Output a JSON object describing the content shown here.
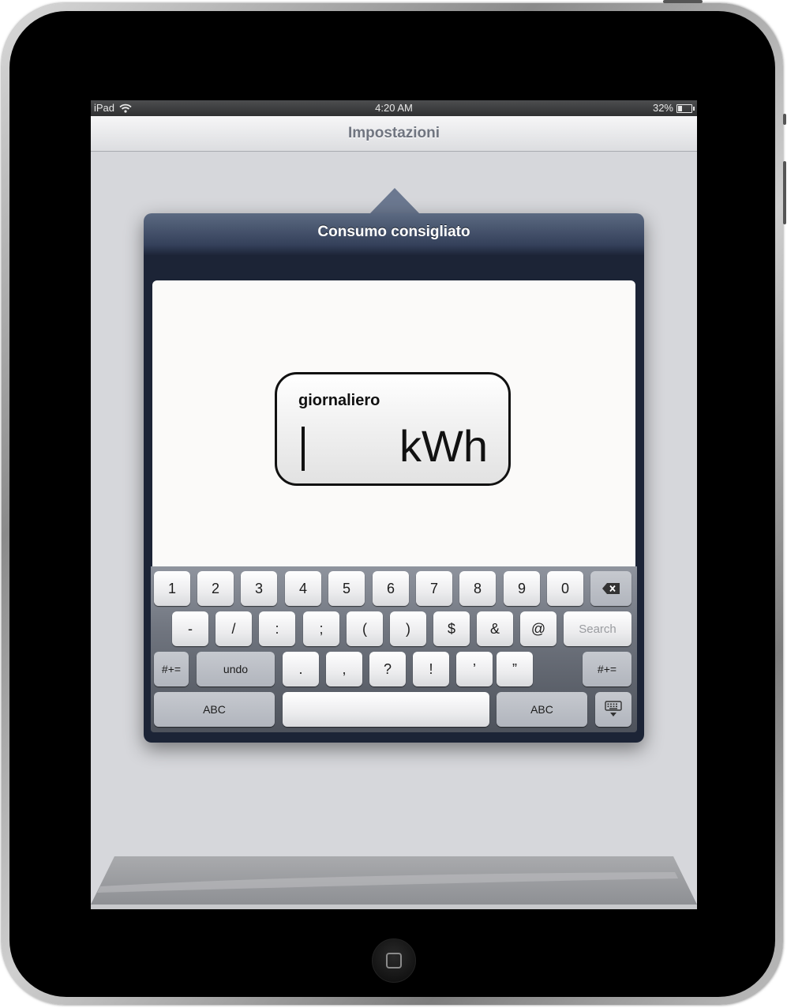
{
  "status_bar": {
    "device": "iPad",
    "time": "4:20 AM",
    "battery": "32%",
    "battery_level": 0.32
  },
  "nav_bar": {
    "title": "Impostazioni"
  },
  "popover": {
    "title": "Consumo consigliato",
    "field": {
      "label": "giornaliero",
      "value": "",
      "unit": "kWh"
    }
  },
  "keyboard": {
    "row1": [
      "1",
      "2",
      "3",
      "4",
      "5",
      "6",
      "7",
      "8",
      "9",
      "0"
    ],
    "row2": [
      "-",
      "/",
      ":",
      ";",
      "(",
      ")",
      "$",
      "&",
      "@"
    ],
    "search_label": "Search",
    "row3_left": "#+=",
    "undo_label": "undo",
    "row3": [
      ".",
      ",",
      "?",
      "!",
      "’",
      "”"
    ],
    "row3_right": "#+=",
    "abc_left": "ABC",
    "abc_right": "ABC",
    "icons": {
      "backspace": "backspace-icon",
      "dismiss": "keyboard-dismiss-icon"
    }
  },
  "colors": {
    "popover_header": "#34405a",
    "nav_title": "#707580",
    "screen_background": "#d6d7db"
  }
}
